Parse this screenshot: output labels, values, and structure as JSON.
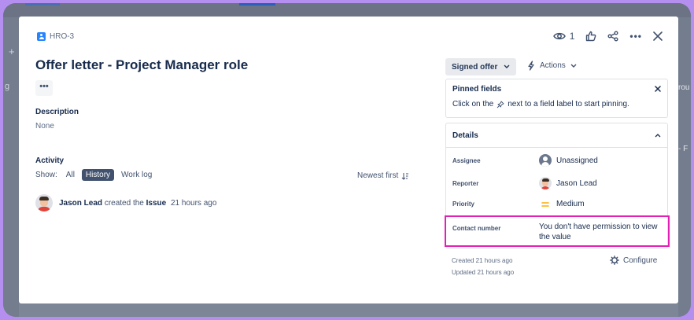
{
  "background": {
    "plus": "+",
    "left_letter": "g",
    "right_snippets": [
      "rou",
      "- F"
    ]
  },
  "issue": {
    "key": "HRO-3",
    "title": "Offer letter - Project Manager role",
    "more_label": "•••",
    "description_heading": "Description",
    "description_value": "None"
  },
  "top_actions": {
    "watch_count": "1",
    "more_label": "•••"
  },
  "activity": {
    "heading": "Activity",
    "show_label": "Show:",
    "filters": [
      "All",
      "History",
      "Work log"
    ],
    "active_filter": "History",
    "sort_label": "Newest first",
    "entries": [
      {
        "user": "Jason Lead",
        "action": "created the",
        "object": "Issue",
        "time": "21 hours ago"
      }
    ]
  },
  "status": {
    "label": "Signed offer"
  },
  "actions": {
    "label": "Actions"
  },
  "pinned": {
    "heading": "Pinned fields",
    "text_before": "Click on the",
    "text_after": "next to a field label to start pinning."
  },
  "details": {
    "heading": "Details",
    "assignee_label": "Assignee",
    "assignee_value": "Unassigned",
    "reporter_label": "Reporter",
    "reporter_value": "Jason Lead",
    "priority_label": "Priority",
    "priority_value": "Medium",
    "contact_label": "Contact number",
    "contact_value": "You don't have permission to view the value"
  },
  "meta": {
    "created": "Created 21 hours ago",
    "updated": "Updated 21 hours ago",
    "configure": "Configure"
  },
  "colors": {
    "highlight": "#e41fb8",
    "active_chip": "#42526e",
    "frame_border": "#b58ff0"
  }
}
